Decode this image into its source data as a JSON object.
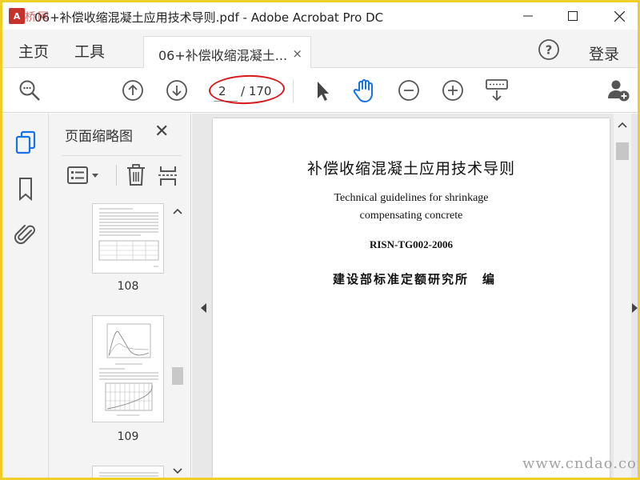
{
  "window": {
    "title": "06+补偿收缩混凝土应用技术导则.pdf - Adobe Acrobat Pro DC",
    "watermark_top": "桥网"
  },
  "menubar": {
    "home": "主页",
    "tools": "工具",
    "tab_label": "06+补偿收缩混凝土...",
    "tab_close": "×",
    "login": "登录"
  },
  "toolbar": {
    "current_page": "2",
    "total_pages": "/ 170"
  },
  "panel": {
    "title": "页面缩略图",
    "close": "✕",
    "thumbnails": [
      {
        "label": "108"
      },
      {
        "label": "109"
      }
    ]
  },
  "document": {
    "cn_title": "补偿收缩混凝土应用技术导则",
    "en_title_line1": "Technical guidelines for shrinkage",
    "en_title_line2": "compensating concrete",
    "code": "RISN-TG002-2006",
    "org": "建设部标准定额研究所　编"
  },
  "watermark": "www.cndao.com",
  "colors": {
    "accent_blue": "#1473e6",
    "highlight_red": "#d9191c",
    "frame_yellow": "#f0ce2a"
  }
}
